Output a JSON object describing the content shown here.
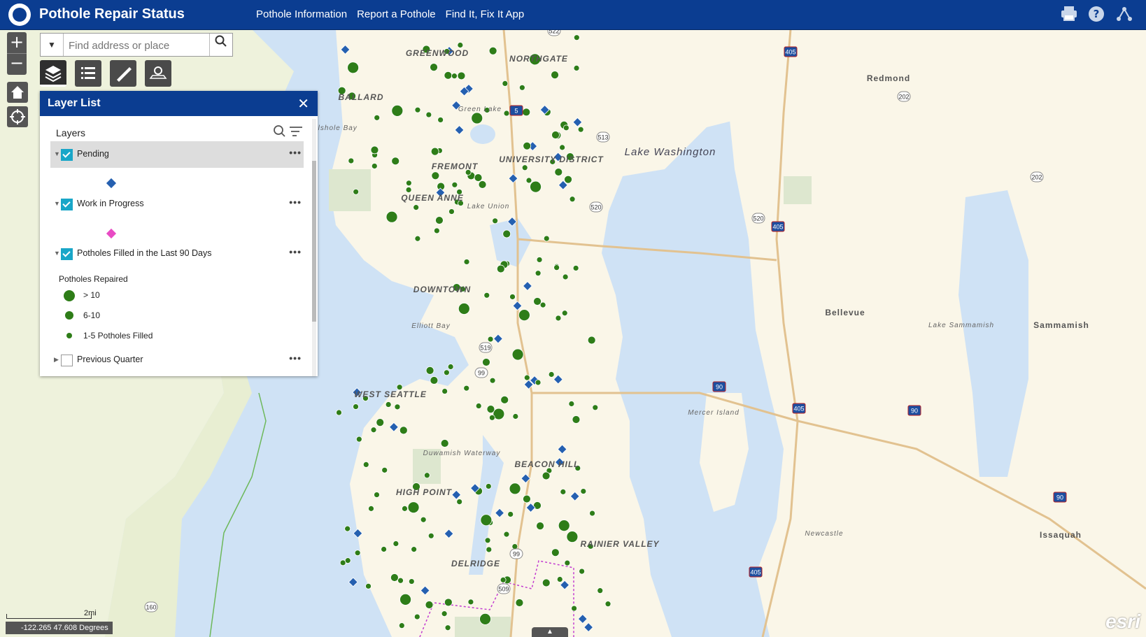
{
  "header": {
    "title": "Pothole Repair Status",
    "nav": [
      "Pothole Information",
      "Report a Pothole",
      "Find It, Fix It App"
    ]
  },
  "search": {
    "placeholder": "Find address or place"
  },
  "panel": {
    "title": "Layer List",
    "subtitle": "Layers",
    "layers": [
      {
        "label": "Pending",
        "checked": true,
        "selected": true
      },
      {
        "label": "Work in Progress",
        "checked": true
      },
      {
        "label": "Potholes Filled in the Last 90 Days",
        "checked": true
      },
      {
        "label": "Previous Quarter",
        "checked": false
      }
    ],
    "legend_title": "Potholes Repaired",
    "legend": [
      "> 10",
      "6-10",
      "1-5 Potholes Filled"
    ]
  },
  "map": {
    "labels": [
      "Lake Washington",
      "Redmond",
      "Bellevue",
      "Sammamish",
      "Mercer Island",
      "Issaquah",
      "Newcastle",
      "BALLARD",
      "NORTHGATE",
      "UNIVERSITY DISTRICT",
      "QUEEN ANNE",
      "WEST SEATTLE",
      "Elliott Bay",
      "Lake Union",
      "Green Lake",
      "Shilshole Bay",
      "Lake Sammamish",
      "DOWNTOWN",
      "BEACON HILL",
      "RAINIER VALLEY",
      "HIGH POINT",
      "Duwamish Waterway",
      "DELRIDGE",
      "GREENWOOD",
      "FREMONT"
    ],
    "shields": [
      "405",
      "405",
      "405",
      "405",
      "90",
      "90",
      "90",
      "5",
      "520",
      "520",
      "202",
      "202",
      "522",
      "513",
      "99",
      "99",
      "509",
      "519",
      "160"
    ]
  },
  "coords": "-122.265 47.608 Degrees",
  "scale": "2mi",
  "esri": "esri",
  "colors": {
    "header": "#0b3d91",
    "pending": "#2560b0",
    "wip": "#e84bc4",
    "filled": "#2e7d18",
    "water": "#cfe2f5",
    "land": "#faf6e8"
  }
}
